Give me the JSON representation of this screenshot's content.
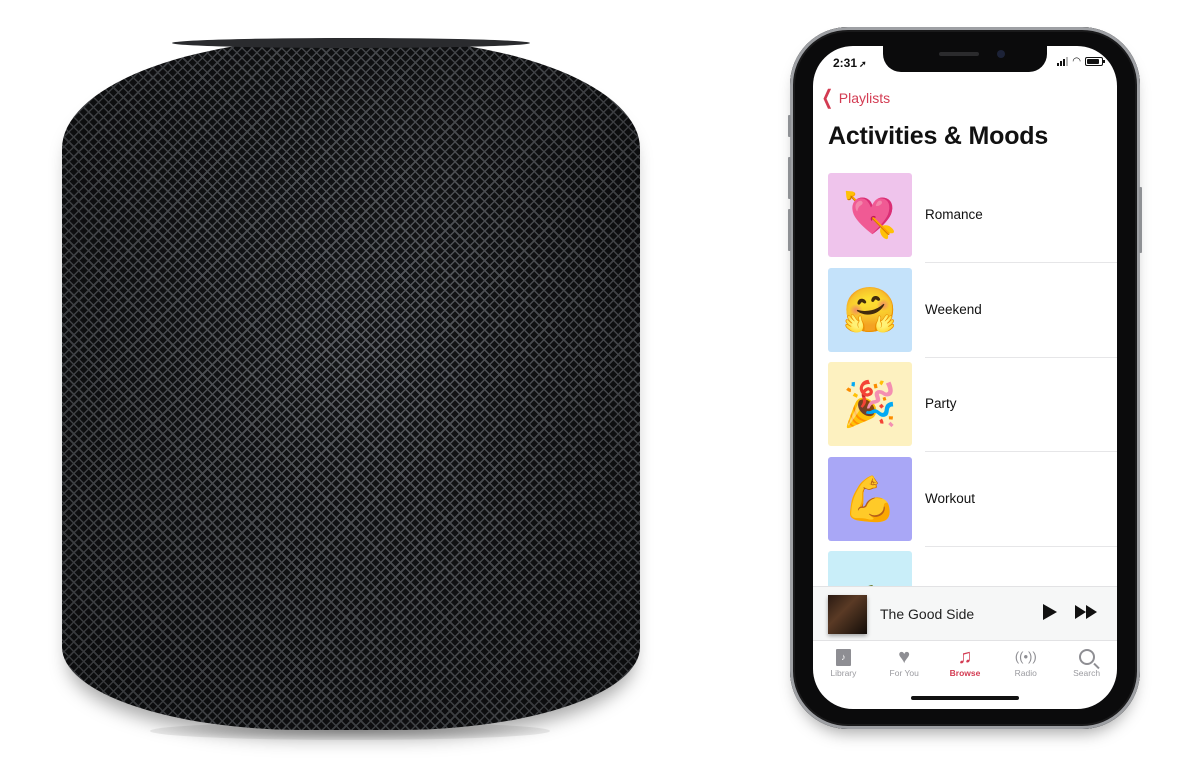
{
  "product_image": {
    "name": "HomePod speaker",
    "color": "space gray"
  },
  "phone": {
    "status_bar": {
      "time": "2:31",
      "location_icon": "location-arrow-icon",
      "icons": [
        "cellular-signal-icon",
        "wifi-icon",
        "battery-icon"
      ]
    },
    "nav": {
      "back_label": "Playlists",
      "back_icon": "chevron-left-icon"
    },
    "page_title": "Activities & Moods",
    "list": [
      {
        "label": "Romance",
        "emoji": "💘",
        "bg": "#efc4ec"
      },
      {
        "label": "Weekend",
        "emoji": "🤗",
        "bg": "#c4e2fa"
      },
      {
        "label": "Party",
        "emoji": "🎉",
        "bg": "#fdf1c0"
      },
      {
        "label": "Workout",
        "emoji": "💪",
        "bg": "#a9a7f6"
      },
      {
        "label": "",
        "emoji": "🌴",
        "bg": "#c9eef9"
      }
    ],
    "mini_player": {
      "title": "The Good Side",
      "play_icon": "play-icon",
      "forward_icon": "fast-forward-icon"
    },
    "tabs": [
      {
        "label": "Library",
        "icon": "library-icon",
        "active": false
      },
      {
        "label": "For You",
        "icon": "heart-icon",
        "active": false
      },
      {
        "label": "Browse",
        "icon": "music-note-icon",
        "active": true
      },
      {
        "label": "Radio",
        "icon": "radio-broadcast-icon",
        "active": false
      },
      {
        "label": "Search",
        "icon": "search-icon",
        "active": false
      }
    ],
    "accent_color": "#d33b52"
  }
}
